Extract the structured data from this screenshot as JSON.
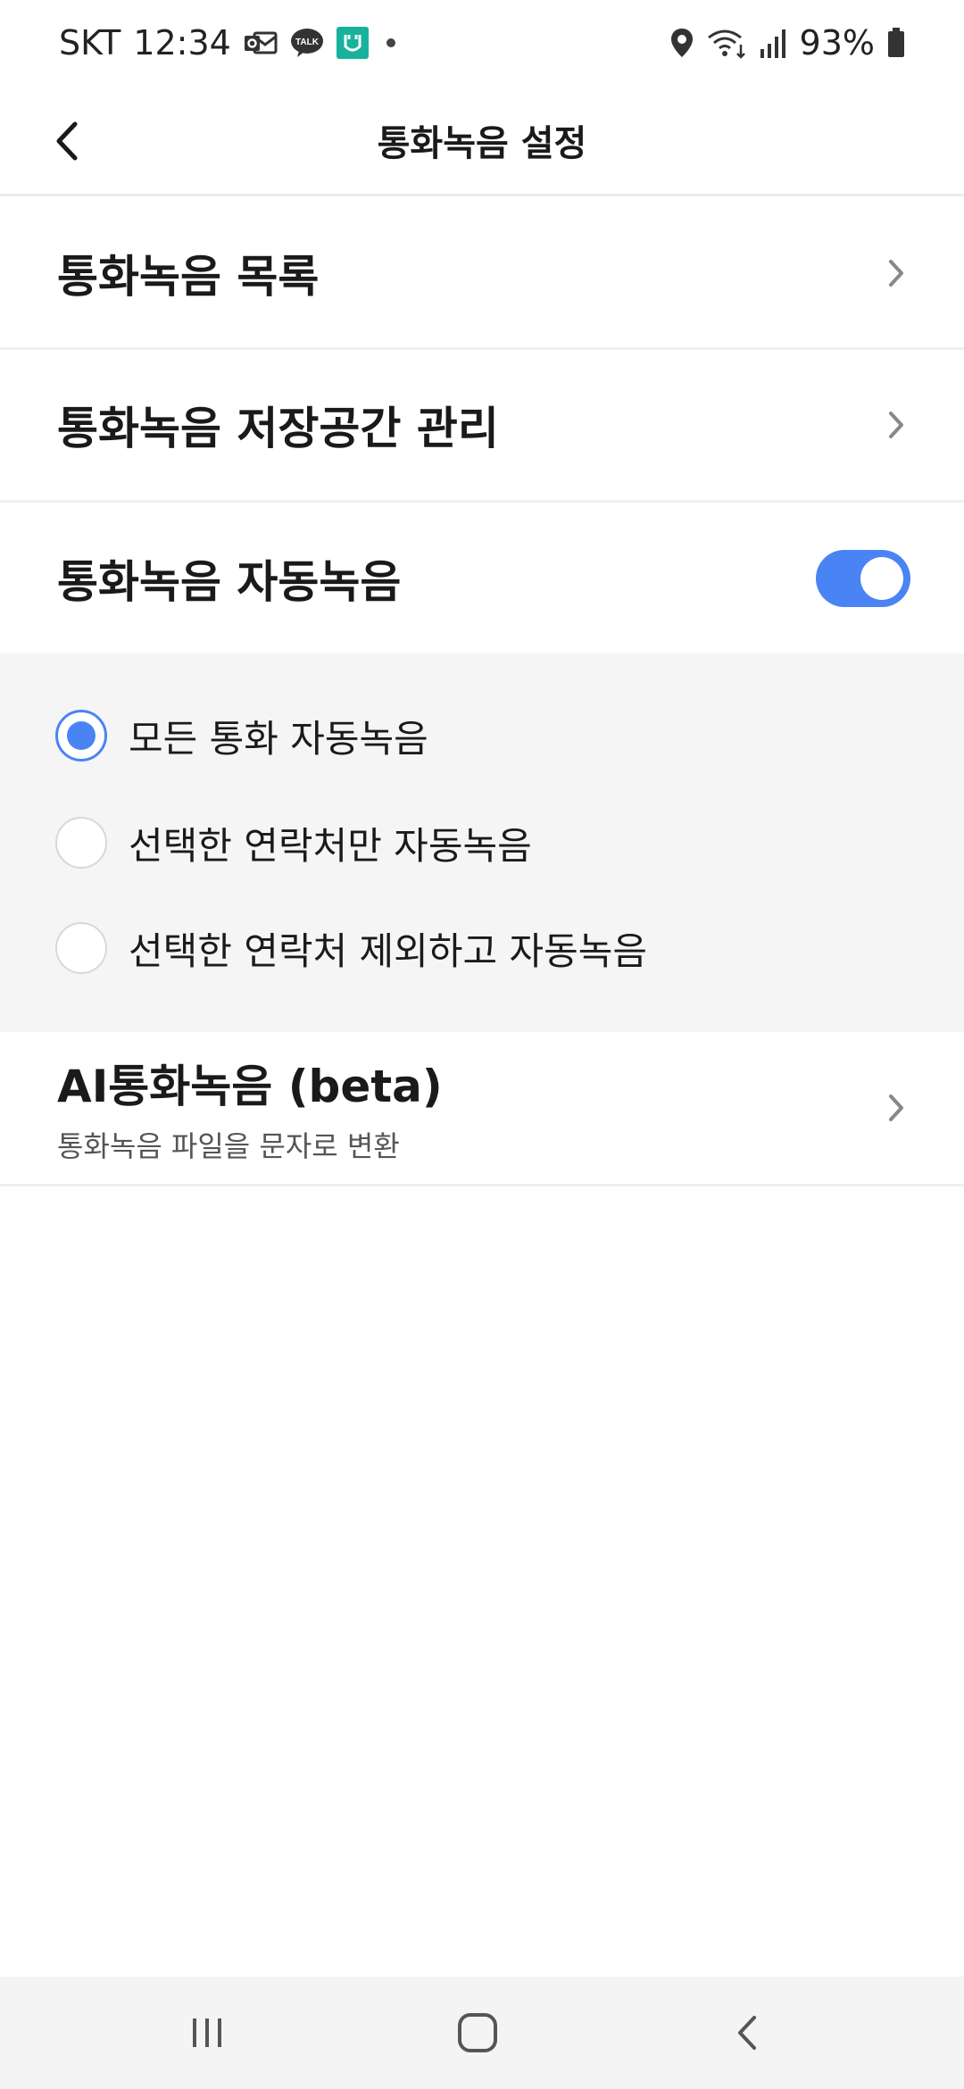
{
  "status_bar": {
    "carrier": "SKT",
    "time": "12:34",
    "notification_icons": [
      "outlook-icon",
      "kakaotalk-icon",
      "miui-app-icon"
    ],
    "kakaotalk_badge": "TALK",
    "right_icons": [
      "location-icon",
      "wifi-icon",
      "signal-icon",
      "battery-icon"
    ],
    "battery": "93%"
  },
  "header": {
    "title": "통화녹음 설정",
    "back_icon": "chevron-left-icon"
  },
  "settings": {
    "call_recording_list": "통화녹음 목록",
    "storage_management": "통화녹음 저장공간 관리",
    "auto_record": {
      "label": "통화녹음 자동녹음",
      "enabled": true
    },
    "auto_record_options": [
      {
        "label": "모든 통화 자동녹음",
        "selected": true
      },
      {
        "label": "선택한 연락처만 자동녹음",
        "selected": false
      },
      {
        "label": "선택한 연락처 제외하고 자동녹음",
        "selected": false
      }
    ],
    "ai_recording": {
      "title": "AI통화녹음 (beta)",
      "subtitle": "통화녹음 파일을 문자로 변환"
    }
  },
  "nav_bar": {
    "icons": [
      "recent-apps-icon",
      "home-icon",
      "back-icon"
    ]
  },
  "colors": {
    "accent": "#4a84f4",
    "panel_bg": "#f5f5f5",
    "divider": "#efefef"
  }
}
